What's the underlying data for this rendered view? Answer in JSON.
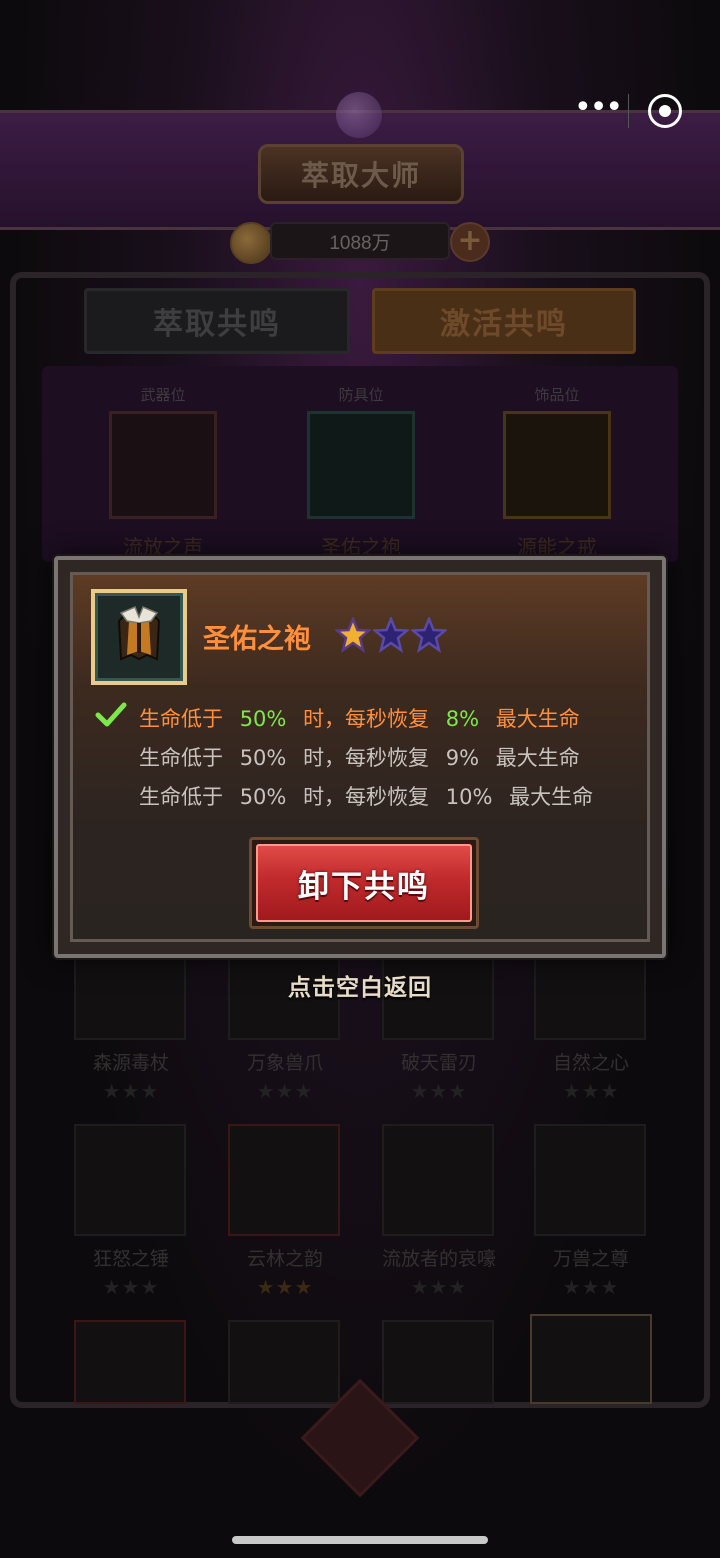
{
  "header": {
    "title": "萃取大师",
    "coins": "1088万"
  },
  "tabs": [
    {
      "label": "萃取共鸣"
    },
    {
      "label": "激活共鸣"
    }
  ],
  "slots": [
    {
      "position": "武器位",
      "name": "流放之声"
    },
    {
      "position": "防具位",
      "name": "圣佑之袍"
    },
    {
      "position": "饰品位",
      "name": "源能之戒"
    }
  ],
  "grid": [
    {
      "name": "森源毒杖",
      "stars": "★★★"
    },
    {
      "name": "万象兽爪",
      "stars": "★★★"
    },
    {
      "name": "破天雷刃",
      "stars": "★★★"
    },
    {
      "name": "自然之心",
      "stars": "★★★"
    },
    {
      "name": "狂怒之锤",
      "stars": "★★★"
    },
    {
      "name": "云林之韵",
      "stars": "★★★"
    },
    {
      "name": "流放者的哀嚎",
      "stars": "★★★"
    },
    {
      "name": "万兽之尊",
      "stars": "★★★"
    }
  ],
  "modal": {
    "item_name": "圣佑之袍",
    "star_rating": 1,
    "star_max": 3,
    "effects": [
      {
        "prefix": "生命低于",
        "threshold": "50%",
        "mid": "时，每秒恢复",
        "value": "8%",
        "suffix": "最大生命",
        "active": true
      },
      {
        "prefix": "生命低于",
        "threshold": "50%",
        "mid": "时，每秒恢复",
        "value": "9%",
        "suffix": "最大生命",
        "active": false
      },
      {
        "prefix": "生命低于",
        "threshold": "50%",
        "mid": "时，每秒恢复",
        "value": "10%",
        "suffix": "最大生命",
        "active": false
      }
    ],
    "unload_label": "卸下共鸣"
  },
  "hint": "点击空白返回",
  "colors": {
    "accent_orange": "#ff8f3a",
    "value_green": "#7de84a",
    "button_red": "#c12a2c",
    "star_gold": "#f0b030",
    "star_empty": "#4a3a9a"
  }
}
